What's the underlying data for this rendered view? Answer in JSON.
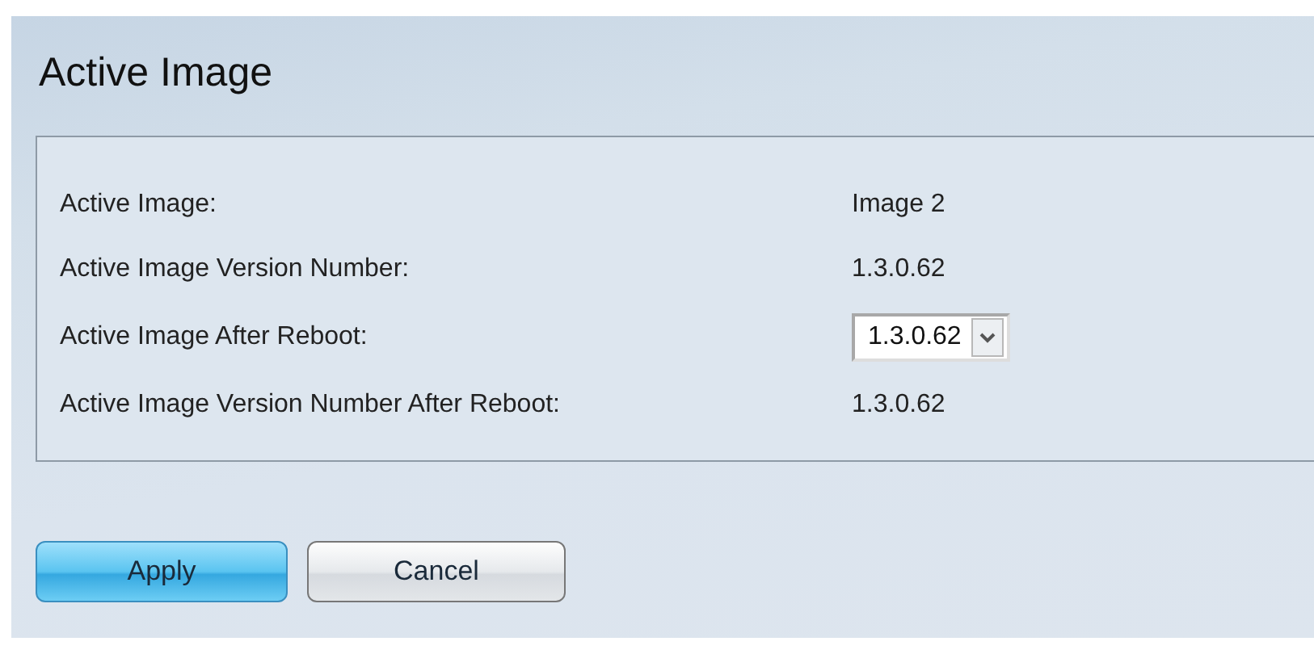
{
  "title": "Active Image",
  "rows": [
    {
      "kind": "text",
      "label": "Active Image:",
      "value": "Image 2"
    },
    {
      "kind": "text",
      "label": "Active Image Version Number:",
      "value": "1.3.0.62"
    },
    {
      "kind": "select",
      "label": "Active Image After Reboot:",
      "value": "1.3.0.62"
    },
    {
      "kind": "text",
      "label": "Active Image Version Number After Reboot:",
      "value": "1.3.0.62"
    }
  ],
  "buttons": [
    {
      "kind": "primary",
      "label": "Apply"
    },
    {
      "kind": "secondary",
      "label": "Cancel"
    }
  ]
}
